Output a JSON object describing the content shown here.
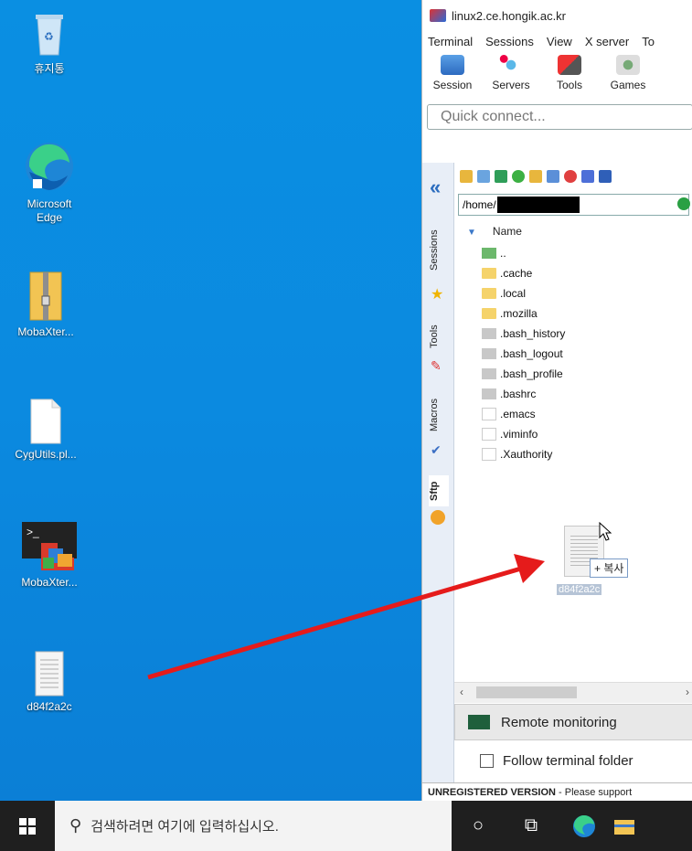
{
  "desktop": {
    "icons": [
      {
        "label": "휴지통",
        "icon": "recycle-bin-icon"
      },
      {
        "label": "Microsoft\nEdge",
        "icon": "edge-icon"
      },
      {
        "label": "MobaXter...",
        "icon": "zip-folder-icon"
      },
      {
        "label": "CygUtils.pl...",
        "icon": "document-icon"
      },
      {
        "label": "MobaXter...",
        "icon": "mobaxterm-icon"
      },
      {
        "label": "d84f2a2c",
        "icon": "text-file-icon"
      }
    ]
  },
  "moba": {
    "title": "linux2.ce.hongik.ac.kr",
    "menu": [
      "Terminal",
      "Sessions",
      "View",
      "X server",
      "To"
    ],
    "toolbar": [
      "Session",
      "Servers",
      "Tools",
      "Games"
    ],
    "quick_connect_placeholder": "Quick connect...",
    "side_tabs": [
      "Sessions",
      "Tools",
      "Macros",
      "Sftp"
    ],
    "path": "/home/",
    "column_name": "Name",
    "files": [
      {
        "name": "..",
        "type": "up"
      },
      {
        "name": ".cache",
        "type": "folder"
      },
      {
        "name": ".local",
        "type": "folder"
      },
      {
        "name": ".mozilla",
        "type": "folder"
      },
      {
        "name": ".bash_history",
        "type": "grey"
      },
      {
        "name": ".bash_logout",
        "type": "grey"
      },
      {
        "name": ".bash_profile",
        "type": "grey"
      },
      {
        "name": ".bashrc",
        "type": "grey"
      },
      {
        "name": ".emacs",
        "type": "page"
      },
      {
        "name": ".viminfo",
        "type": "page"
      },
      {
        "name": ".Xauthority",
        "type": "page"
      }
    ],
    "drag_copy_label": "+ 복사",
    "drag_filename": "d84f2a2c",
    "remote_monitoring": "Remote monitoring",
    "follow_terminal": "Follow terminal folder",
    "unregistered_bold": "UNREGISTERED VERSION",
    "unregistered_rest": " - Please support"
  },
  "taskbar": {
    "search_placeholder": "검색하려면 여기에 입력하십시오."
  },
  "colors": {
    "accent": "#2c6dbf",
    "desktop": "#0a8fe2",
    "arrow": "#e51b1b"
  }
}
